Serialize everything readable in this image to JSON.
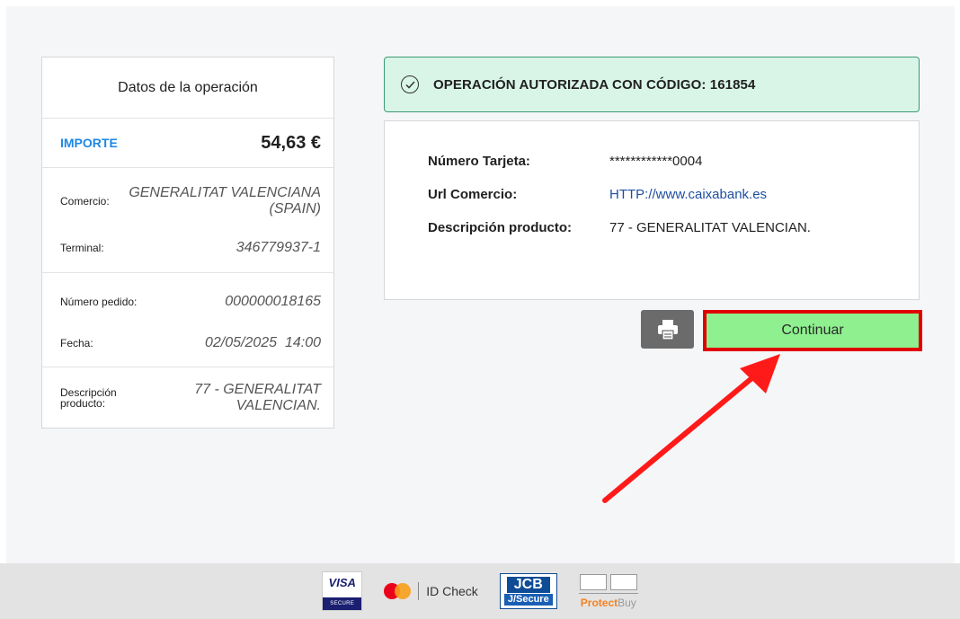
{
  "summary": {
    "title": "Datos de la operación",
    "amount_label": "IMPORTE",
    "amount_value": "54,63 €",
    "fields": [
      {
        "label": "Comercio:",
        "value": "GENERALITAT VALENCIANA (SPAIN)"
      },
      {
        "label": "Terminal:",
        "value": "346779937-1"
      },
      {
        "label": "Número pedido:",
        "value": "000000018165"
      },
      {
        "label": "Fecha:",
        "value": "02/05/2025  14:00"
      },
      {
        "label": "Descripción producto:",
        "value": "77 - GENERALITAT VALENCIAN."
      }
    ]
  },
  "banner": {
    "icon": "check-circle-icon",
    "text": "OPERACIÓN AUTORIZADA CON CÓDIGO: 161854"
  },
  "details": [
    {
      "label": "Número Tarjeta:",
      "value": "************0004"
    },
    {
      "label": "Url Comercio:",
      "value": "HTTP://www.caixabank.es"
    },
    {
      "label": "Descripción producto:",
      "value": "77 - GENERALITAT VALENCIAN."
    }
  ],
  "actions": {
    "print_icon": "printer-icon",
    "continue_label": "Continuar"
  },
  "footer": {
    "visa_top": "VISA",
    "visa_bottom": "SECURE",
    "mc_text": "ID Check",
    "jcb_top": "JCB",
    "jcb_bottom": "J/Secure",
    "discover_brand": "Protect",
    "discover_suffix": "Buy"
  },
  "colors": {
    "banner_bg": "#d9f5e8",
    "banner_border": "#3c9a74",
    "continue_bg": "#8ef08e",
    "highlight_red": "#e00000",
    "amount_label": "#1e88e5"
  }
}
